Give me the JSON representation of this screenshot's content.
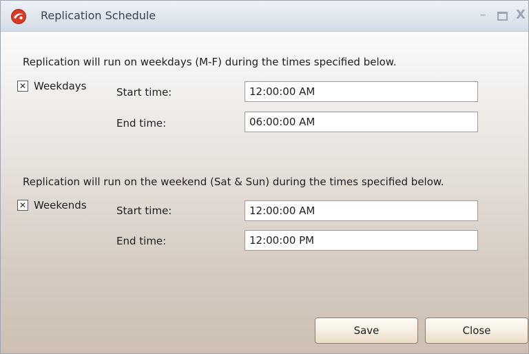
{
  "window": {
    "title": "Replication Schedule",
    "controls": {
      "minimize_icon": "minimize-icon",
      "maximize_icon": "maximize-icon",
      "close_icon": "close-icon",
      "minimize_glyph": "–",
      "close_glyph": "X"
    }
  },
  "weekdays": {
    "description": "Replication will run on weekdays (M-F) during the times specified below.",
    "checkbox_label": "Weekdays",
    "checked": true,
    "check_glyph": "✕",
    "start_label": "Start time:",
    "start_value": "12:00:00 AM",
    "end_label": "End time:",
    "end_value": "06:00:00 AM"
  },
  "weekends": {
    "description": "Replication will run on the weekend (Sat & Sun) during the times specified below.",
    "checkbox_label": "Weekends",
    "checked": true,
    "check_glyph": "✕",
    "start_label": "Start time:",
    "start_value": "12:00:00 AM",
    "end_label": "End time:",
    "end_value": "12:00:00 PM"
  },
  "buttons": {
    "save_label": "Save",
    "close_label": "Close"
  },
  "colors": {
    "app_icon_red": "#d93a22",
    "title_text": "#3a4450",
    "window_controls": "#9aa4b3"
  }
}
